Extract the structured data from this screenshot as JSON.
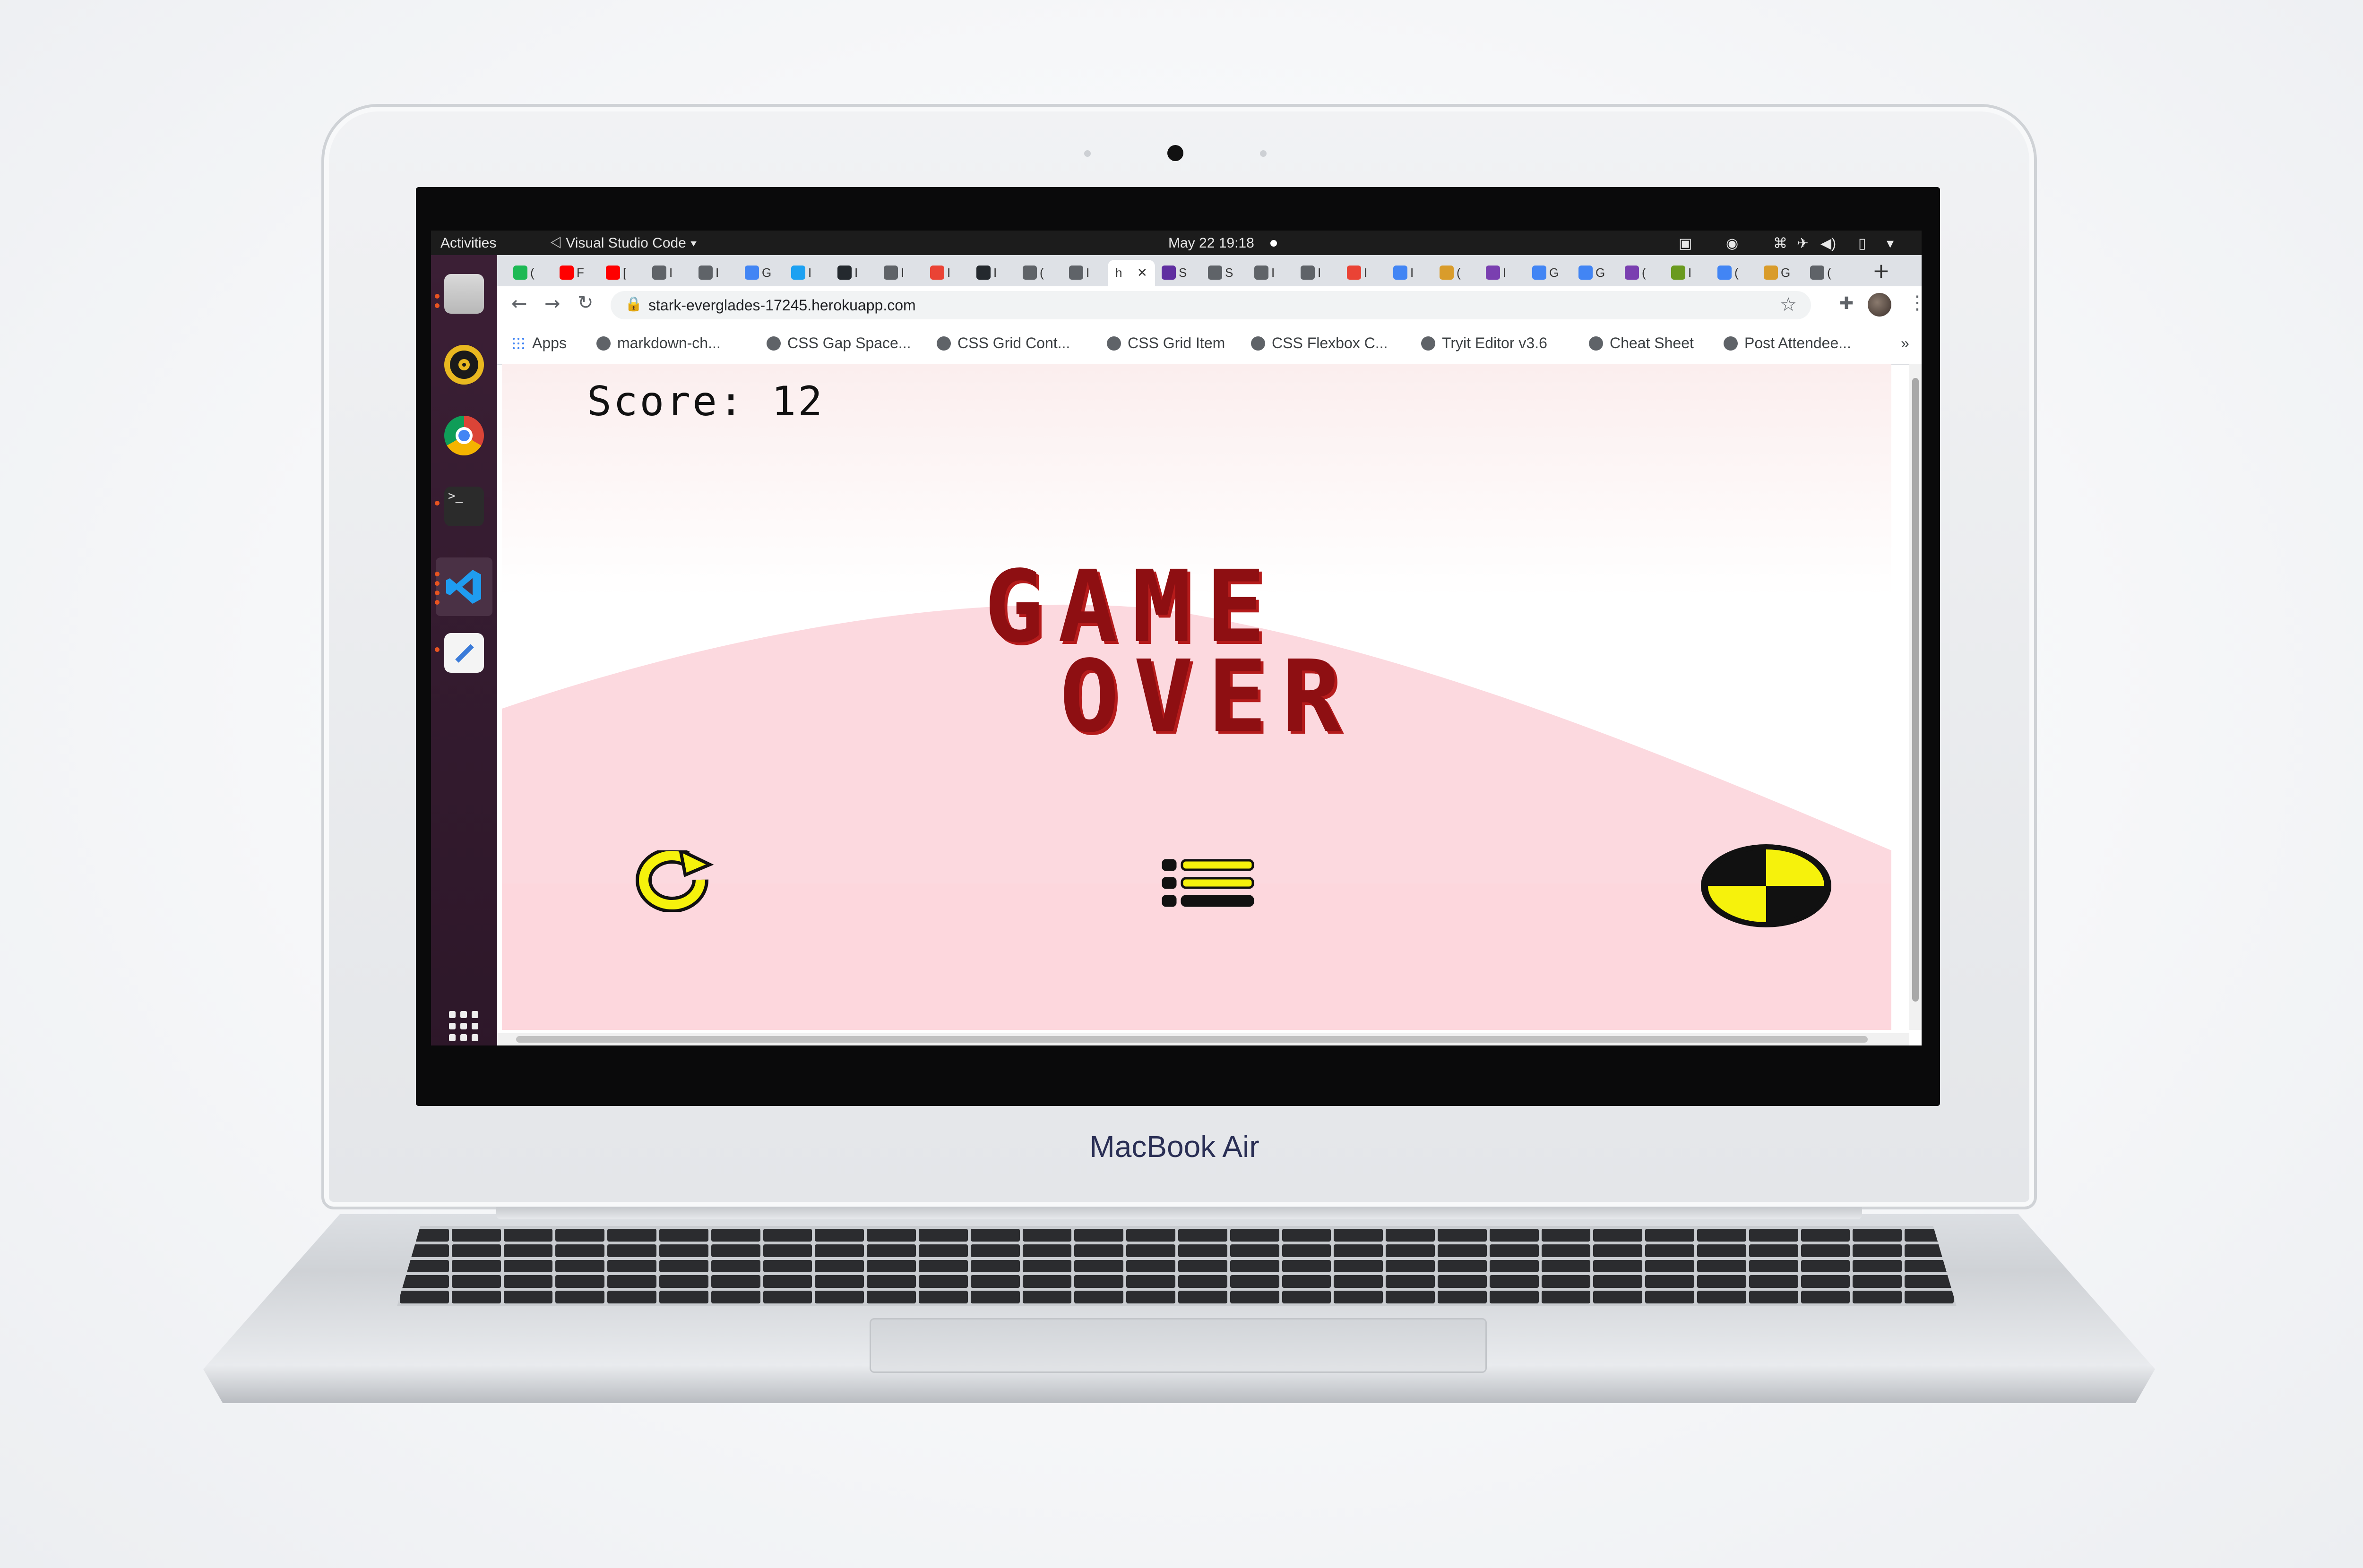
{
  "os": {
    "activities": "Activities",
    "focused_app": "Visual Studio Code",
    "clock": "May 22  19:18"
  },
  "dock": {
    "apps": [
      "files-icon",
      "rhythmbox-icon",
      "chrome-icon",
      "terminal-icon",
      "vscode-icon",
      "text-editor-icon"
    ],
    "show_apps": "show-applications-icon"
  },
  "browser": {
    "url": "stark-everglades-17245.herokuapp.com",
    "active_tab": "h",
    "tabs": [
      "(",
      "F",
      "[",
      "I",
      "I",
      "G",
      "I",
      "I",
      "I",
      "I",
      "I",
      "(",
      "I",
      "h",
      "S",
      "S",
      "I",
      "I",
      "I",
      "I",
      "(",
      "I",
      "G",
      "G",
      "(",
      "I",
      "(",
      "G",
      "("
    ],
    "bookmarks": [
      "Apps",
      "markdown-ch...",
      "CSS Gap Space...",
      "CSS Grid Cont...",
      "CSS Grid Item",
      "CSS Flexbox C...",
      "Tryit Editor v3.6",
      "Cheat Sheet",
      "Post Attendee..."
    ],
    "more_bookmarks": "»"
  },
  "game": {
    "score_label": "Score:",
    "score_value": "12",
    "title_line1": "GAME",
    "title_line2": "OVER",
    "buttons": [
      "restart-icon",
      "menu-icon",
      "target-icon"
    ]
  },
  "colors": {
    "game_over": "#8e0f12",
    "hill": "#fcd9df",
    "ubuntu_accent": "#e95420",
    "button_yellow": "#f6f20c"
  },
  "device": {
    "brand": "MacBook Air"
  }
}
